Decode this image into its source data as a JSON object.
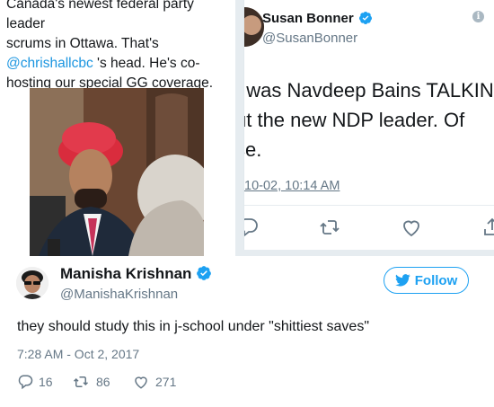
{
  "left_card": {
    "line1": "Canada's newest federal party leader",
    "line2": "scrums in Ottawa.  That's",
    "mention": "@chrishallcbc",
    "line3_rest": " 's head. He's co-",
    "line4": "hosting our special GG coverage."
  },
  "right_card": {
    "name": "Susan Bonner",
    "handle": "@SusanBonner",
    "body_line1": "t was Navdeep Bains TALKIN",
    "body_line2": "ut the new NDP leader.  Of",
    "body_line3": "se.",
    "timestamp": "10-02, 10:14 AM"
  },
  "tweet": {
    "author_name": "Manisha Krishnan",
    "author_handle": "@ManishaKrishnan",
    "follow_label": "Follow",
    "text": "they should study this in j-school under \"shittiest saves\"",
    "timestamp": "7:28 AM - Oct 2, 2017",
    "replies": "16",
    "retweets": "86",
    "likes": "271"
  },
  "colors": {
    "accent": "#1da1f2",
    "secondary_text": "#657786",
    "mention": "#1b95e0"
  },
  "icons": [
    "verified-icon",
    "info-icon",
    "reply-icon",
    "retweet-icon",
    "like-icon",
    "share-icon",
    "twitter-bird-icon"
  ]
}
